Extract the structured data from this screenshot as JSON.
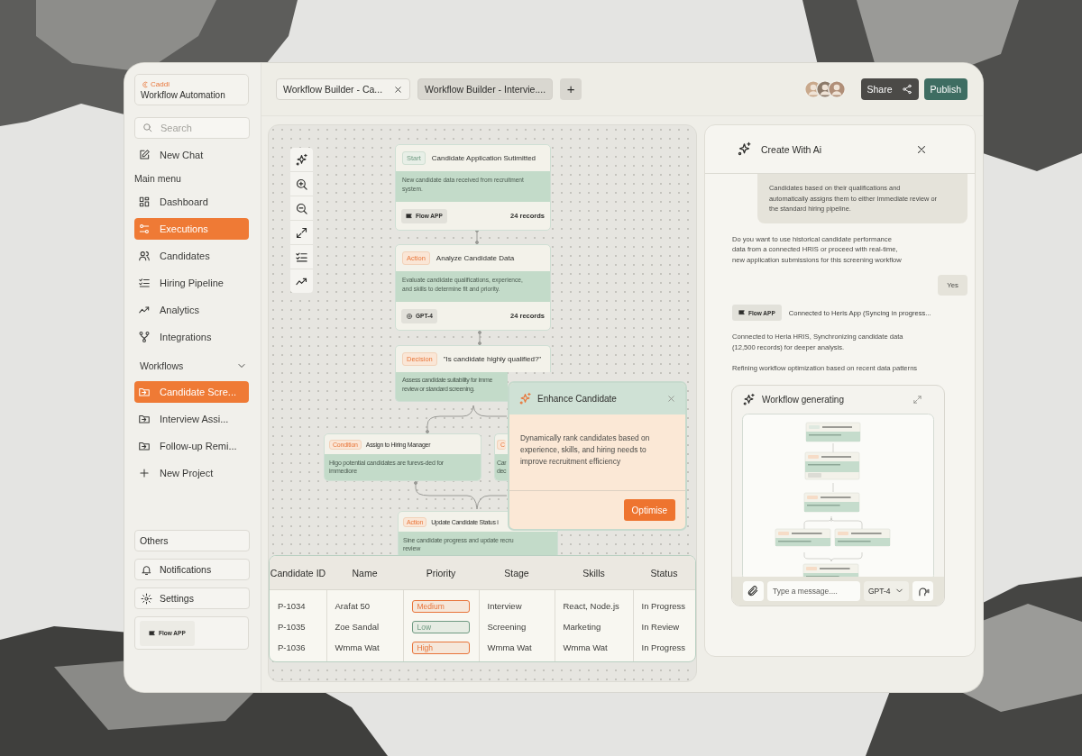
{
  "sidebar": {
    "brand": "Caddi",
    "subtitle": "Workflow Automation",
    "search": {
      "placeholder": "Search"
    },
    "new_chat": "New Chat",
    "main_menu": {
      "title": "Main menu",
      "items": [
        {
          "label": "Dashboard",
          "selected": false
        },
        {
          "label": "Executions",
          "selected": true
        },
        {
          "label": "Candidates",
          "selected": false
        },
        {
          "label": "Hiring Pipeline",
          "selected": false
        },
        {
          "label": "Analytics",
          "selected": false
        },
        {
          "label": "Integrations",
          "selected": false
        }
      ]
    },
    "workflows": {
      "title": "Workflows",
      "expanded": true,
      "items": [
        {
          "label": "Candidate Scre...",
          "selected": true
        },
        {
          "label": "Interview Assi...",
          "selected": false
        },
        {
          "label": "Follow-up Remi...",
          "selected": false
        }
      ]
    },
    "new_project": "New Project",
    "others": "Others",
    "bottom_items": [
      "Notifications",
      "Settings"
    ],
    "app_badge": "Flow APP"
  },
  "tabs": [
    {
      "label": "Workflow Builder - Ca...",
      "selected": true
    },
    {
      "label": "Workflow Builder - Intervie....",
      "selected": false
    }
  ],
  "new_tab": "+",
  "share": "Share",
  "publish": "Publish",
  "canvas": {
    "nodes": [
      {
        "kind": "start",
        "tag": "Start",
        "title": "Candidate Application Sutimitted",
        "body": "New candidate data received from recruitment\nsystem.",
        "app": "Flow APP",
        "count": "24 records"
      },
      {
        "kind": "action",
        "tag": "Action",
        "title": "Analyze Candidate Data",
        "body": "Evaluate candidate qualifications, experience,\nand skills to determine fit and priority.",
        "app": "GPT-4",
        "count": "24 records"
      },
      {
        "kind": "decision",
        "tag": "Decision",
        "title": "\"Is candidate highly qualified?\"",
        "body": "Assess candidate suitability for imme\nreview or standard screening."
      },
      {
        "kind": "condition",
        "tag": "Condition",
        "title": "Assign to Hiring Manager",
        "body": "Higo potential candidates are furevs-ded for\nimmediore"
      },
      {
        "kind": "condition",
        "tag": "C",
        "body": "Car\ndec"
      },
      {
        "kind": "action",
        "tag": "Action",
        "title": "Update Candidate Status i",
        "body": "Sine candidate progress and update recru\nreview"
      }
    ],
    "popup": {
      "title": "Enhance Candidate",
      "body": "Dynamically rank candidates based on experience, skills, and hiring needs to improve recruitment efficiency",
      "button": "Optimise"
    }
  },
  "table": {
    "columns": [
      "Candidate ID",
      "Name",
      "Priority",
      "Stage",
      "Skills",
      "Status"
    ],
    "rows": [
      {
        "cells": [
          {
            "text": "P-1034"
          },
          {
            "text": "Arafat 50"
          },
          {
            "text": "Medium",
            "color": "#e8743a"
          },
          {
            "text": "Interview"
          },
          {
            "text": "React, Node.js"
          },
          {
            "text": "In Progress"
          }
        ]
      },
      {
        "cells": [
          {
            "text": "P-1035"
          },
          {
            "text": "Zoe Sandal"
          },
          {
            "text": "Low",
            "color": "#6f9a82"
          },
          {
            "text": "Screening"
          },
          {
            "text": "Marketing"
          },
          {
            "text": "In Review"
          }
        ]
      },
      {
        "cells": [
          {
            "text": "P-1036"
          },
          {
            "text": "Wmma Wat"
          },
          {
            "text": "High",
            "color": "#e8743a"
          },
          {
            "text": "Wmma Wat"
          },
          {
            "text": "Wmma Wat"
          },
          {
            "text": "In Progress"
          }
        ]
      }
    ]
  },
  "ai_panel": {
    "title": "Create With Ai",
    "messages": [
      {
        "kind": "user",
        "text": "Candidates based on their qualifications and\nautomatically assigns them to either Immediate review or\nthe standard hiring pipeline."
      },
      {
        "kind": "assistant",
        "text": "Do you want to use historical candidate performance\ndata from a connected HRIS or proceed with real-time,\nnew application submissions for this screening workflow"
      },
      {
        "kind": "user_short",
        "text": "Yes"
      },
      {
        "kind": "integration",
        "badge": "Flow APP",
        "text": "Connected to Heris App (Syncing in progress..."
      },
      {
        "kind": "assistant",
        "text": "Connected to Heria HRIS, Synchronizing candidate data\n(12,500 records) for deeper analysis."
      },
      {
        "kind": "assistant",
        "text": "Refining workflow optimization based on recent data patterns"
      }
    ],
    "generating": {
      "title": "Workflow generating"
    },
    "composer": {
      "placeholder": "Type a message....",
      "model": "GPT-4"
    }
  }
}
